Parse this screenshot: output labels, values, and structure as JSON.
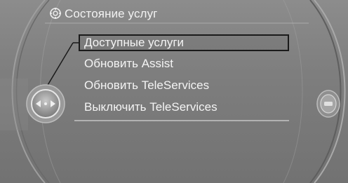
{
  "header": {
    "title": "Состояние услуг",
    "icon": "settings-gear-icon"
  },
  "menu": {
    "items": [
      {
        "label": "Доступные услуги",
        "selected": true
      },
      {
        "label": "Обновить Assist",
        "selected": false
      },
      {
        "label": "Обновить TeleServices",
        "selected": false
      },
      {
        "label": "Выключить TeleServices",
        "selected": false
      }
    ]
  },
  "controller": {
    "icon": "controller-left-right-icon"
  },
  "right_knob": {
    "icon": "right-side-knob-icon"
  },
  "colors": {
    "text": "#f4f4f4",
    "background": "#808080",
    "selection_border": "#1a1a1a"
  }
}
